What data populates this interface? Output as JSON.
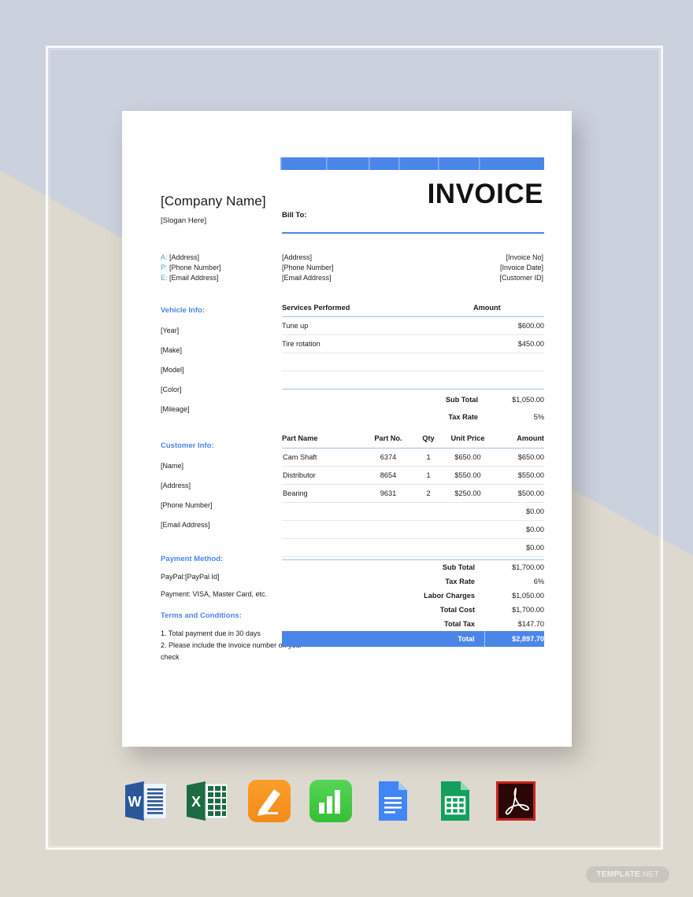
{
  "backdrop": {
    "panel_color": "#ccd1de",
    "wedge_color": "#ddd9cf"
  },
  "accent": {
    "blue": "#4a86e8",
    "light_blue": "#9dc3e6",
    "label_blue": "#5b9bd5"
  },
  "document": {
    "title": "INVOICE",
    "company_name": "[Company Name]",
    "slogan": "[Slogan Here]",
    "bill_to_label": "Bill To:",
    "contact": {
      "address_key": "A:",
      "address_value": "[Address]",
      "phone_key": "P:",
      "phone_value": "[Phone Number]",
      "email_key": "E:",
      "email_value": "[Email Address]"
    },
    "bill_to_lines": [
      "[Address]",
      "[Phone Number]",
      "[Email Address]"
    ],
    "meta_lines": [
      "[Invoice No]",
      "[Invoice Date]",
      "[Customer ID]"
    ],
    "vehicle_info": {
      "heading": "Vehicle Info:",
      "items": [
        "[Year]",
        "[Make]",
        "[Model]",
        "[Color]",
        "[Mileage]"
      ]
    },
    "customer_info": {
      "heading": "Customer Info:",
      "items": [
        "[Name]",
        "[Address]",
        "[Phone Number]",
        "[Email Address]"
      ]
    },
    "payment_method": {
      "heading": "Payment Method:",
      "lines": [
        "PayPal:[PayPal Id]",
        "Payment: VISA, Master Card, etc."
      ]
    },
    "terms": {
      "heading": "Terms and Conditions:",
      "lines": [
        "1. Total payment due in 30 days",
        "2. Please include the invoice number on your",
        "check"
      ]
    },
    "services_table": {
      "headers": [
        "Services Performed",
        "Amount"
      ],
      "rows": [
        {
          "service": "Tune up",
          "amount": "$600.00"
        },
        {
          "service": "Tire rotation",
          "amount": "$450.00"
        },
        {
          "service": "",
          "amount": ""
        },
        {
          "service": "",
          "amount": ""
        }
      ],
      "totals": [
        {
          "label": "Sub Total",
          "value": "$1,050.00"
        },
        {
          "label": "Tax Rate",
          "value": "5%"
        }
      ]
    },
    "parts_table": {
      "headers": [
        "Part Name",
        "Part No.",
        "Qty",
        "Unit Price",
        "Amount"
      ],
      "rows": [
        {
          "name": "Cam Shaft",
          "no": "6374",
          "qty": "1",
          "unit": "$650.00",
          "amount": "$650.00"
        },
        {
          "name": "Distributor",
          "no": "8654",
          "qty": "1",
          "unit": "$550.00",
          "amount": "$550.00"
        },
        {
          "name": "Bearing",
          "no": "9631",
          "qty": "2",
          "unit": "$250.00",
          "amount": "$500.00"
        },
        {
          "name": "",
          "no": "",
          "qty": "",
          "unit": "",
          "amount": "$0.00"
        },
        {
          "name": "",
          "no": "",
          "qty": "",
          "unit": "",
          "amount": "$0.00"
        },
        {
          "name": "",
          "no": "",
          "qty": "",
          "unit": "",
          "amount": "$0.00"
        }
      ]
    },
    "final_totals": {
      "rows": [
        {
          "label": "Sub Total",
          "value": "$1,700.00"
        },
        {
          "label": "Tax Rate",
          "value": "6%"
        },
        {
          "label": "Labor Charges",
          "value": "$1,050.00"
        },
        {
          "label": "Total Cost",
          "value": "$1,700.00"
        },
        {
          "label": "Total Tax",
          "value": "$147.70"
        }
      ],
      "grand": {
        "label": "Total",
        "value": "$2,897.70"
      }
    }
  },
  "format_icons": [
    {
      "name": "word-icon",
      "label": "W"
    },
    {
      "name": "excel-icon",
      "label": "X"
    },
    {
      "name": "pages-icon",
      "label": ""
    },
    {
      "name": "numbers-icon",
      "label": ""
    },
    {
      "name": "google-docs-icon",
      "label": ""
    },
    {
      "name": "google-sheets-icon",
      "label": ""
    },
    {
      "name": "pdf-icon",
      "label": ""
    }
  ],
  "watermark": {
    "bold": "TEMPLATE",
    "rest": ".NET"
  }
}
